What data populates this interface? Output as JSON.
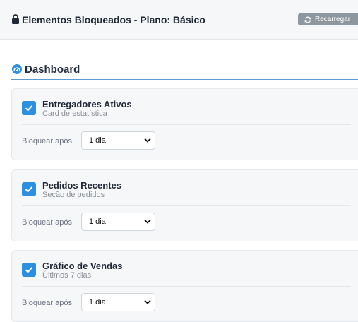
{
  "header": {
    "title": "Elementos Bloqueados - Plano: Básico",
    "reload_label": "Recarregar",
    "lock_icon": "lock-icon",
    "reload_icon": "refresh-icon"
  },
  "section": {
    "title": "Dashboard",
    "icon": "dashboard-gauge-icon",
    "accent": "#5b9bd5"
  },
  "cards": [
    {
      "name": "Entregadores Ativos",
      "subtitle": "Card de estatística",
      "checked": true,
      "block_label": "Bloquear após:",
      "block_value": "1 dia"
    },
    {
      "name": "Pedidos Recentes",
      "subtitle": "Seção de pedidos",
      "checked": true,
      "block_label": "Bloquear após:",
      "block_value": "1 dia"
    },
    {
      "name": "Gráfico de Vendas",
      "subtitle": "Últimos 7 dias",
      "checked": true,
      "block_label": "Bloquear após:",
      "block_value": "1 dia"
    }
  ],
  "colors": {
    "checkbox": "#2d8fe0",
    "reload_button": "#8e979e",
    "card_bg": "#f6f7f9"
  }
}
